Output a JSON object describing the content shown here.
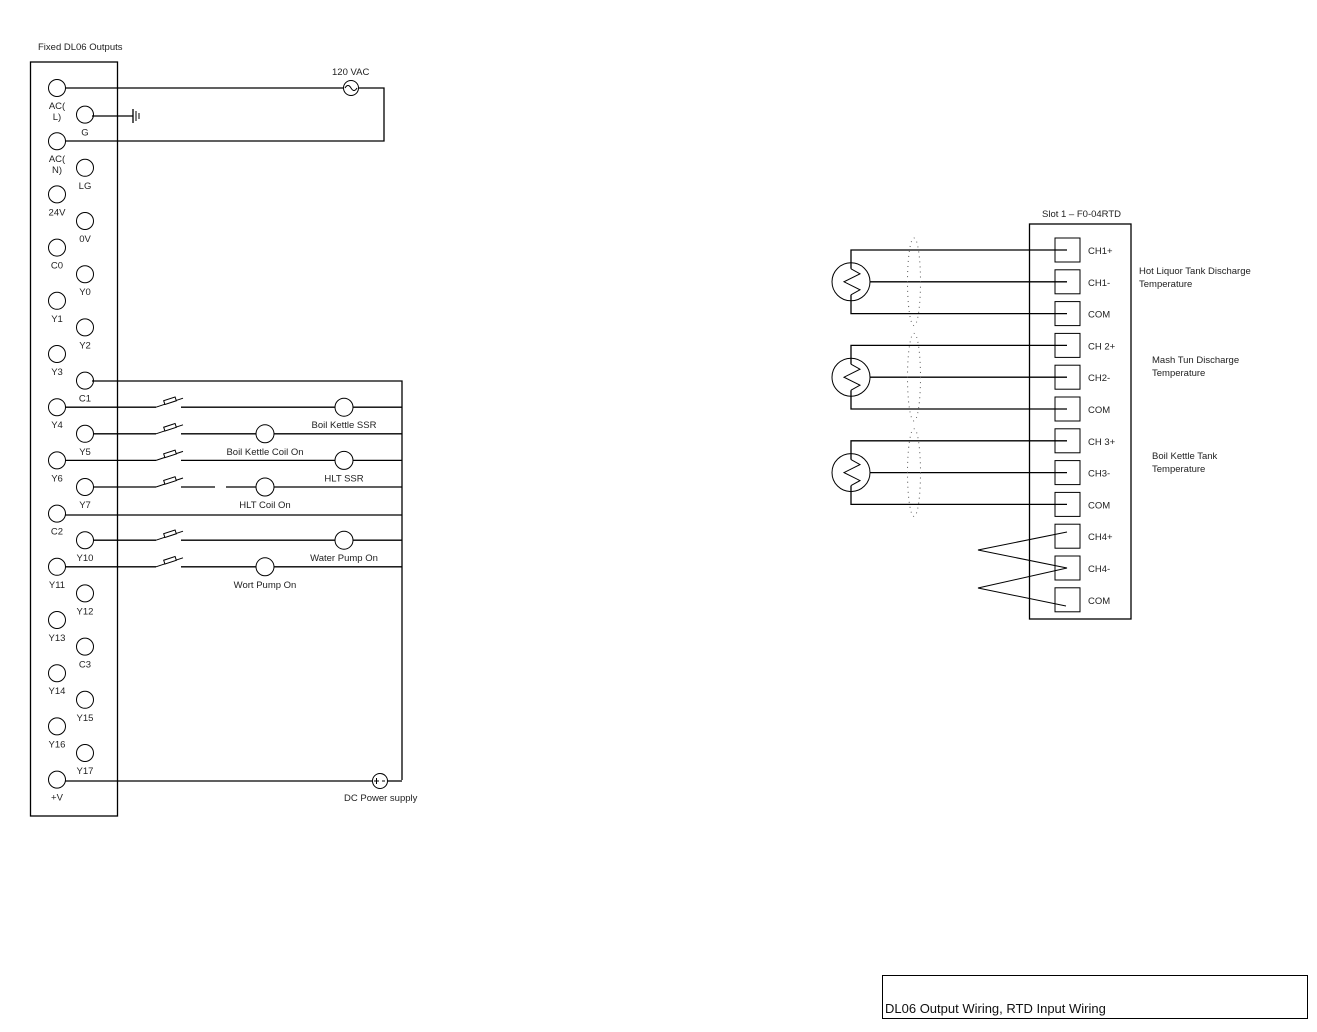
{
  "plc": {
    "title": "Fixed DL06 Outputs",
    "terminals": [
      {
        "label": "AC(\nL)",
        "col": "left"
      },
      {
        "label": "G",
        "col": "right"
      },
      {
        "label": "AC(\nN)",
        "col": "left"
      },
      {
        "label": "LG",
        "col": "right"
      },
      {
        "label": "24V",
        "col": "left"
      },
      {
        "label": "0V",
        "col": "right"
      },
      {
        "label": "C0",
        "col": "left"
      },
      {
        "label": "Y0",
        "col": "right"
      },
      {
        "label": "Y1",
        "col": "left"
      },
      {
        "label": "Y2",
        "col": "right"
      },
      {
        "label": "Y3",
        "col": "left"
      },
      {
        "label": "C1",
        "col": "right"
      },
      {
        "label": "Y4",
        "col": "left"
      },
      {
        "label": "Y5",
        "col": "right"
      },
      {
        "label": "Y6",
        "col": "left"
      },
      {
        "label": "Y7",
        "col": "right"
      },
      {
        "label": "C2",
        "col": "left"
      },
      {
        "label": "Y10",
        "col": "right"
      },
      {
        "label": "Y11",
        "col": "left"
      },
      {
        "label": "Y12",
        "col": "right"
      },
      {
        "label": "Y13",
        "col": "left"
      },
      {
        "label": "C3",
        "col": "right"
      },
      {
        "label": "Y14",
        "col": "left"
      },
      {
        "label": "Y15",
        "col": "right"
      },
      {
        "label": "Y16",
        "col": "left"
      },
      {
        "label": "Y17",
        "col": "right"
      },
      {
        "label": "+V",
        "col": "left"
      }
    ]
  },
  "power": {
    "ac_source_label": "120 VAC",
    "dc_source_label": "DC Power supply"
  },
  "output_loads": [
    {
      "terminal": "Y4",
      "label": "Boil Kettle SSR",
      "fused": true
    },
    {
      "terminal": "Y5",
      "label": "Boil Kettle Coil On",
      "fused": true
    },
    {
      "terminal": "Y6",
      "label": "HLT SSR",
      "fused": true
    },
    {
      "terminal": "Y7",
      "label": "HLT Coil On",
      "fused": true
    },
    {
      "terminal": "Y10",
      "label": "Water Pump On",
      "fused": true
    },
    {
      "terminal": "Y11",
      "label": "Wort Pump On",
      "fused": true
    }
  ],
  "rtd_module": {
    "title": "Slot 1 – F0-04RTD",
    "terminals": [
      "CH1+",
      "CH1-",
      "COM",
      "CH 2+",
      "CH2-",
      "COM",
      "CH 3+",
      "CH3-",
      "COM",
      "CH4+",
      "CH4-",
      "COM"
    ],
    "channels": [
      {
        "line1": "Hot Liquor Tank Discharge",
        "line2": "Temperature"
      },
      {
        "line1": "Mash Tun Discharge",
        "line2": "Temperature"
      },
      {
        "line1": "Boil Kettle Tank",
        "line2": "Temperature"
      }
    ]
  },
  "title_block": {
    "text": "DL06 Output Wiring, RTD Input Wiring"
  }
}
